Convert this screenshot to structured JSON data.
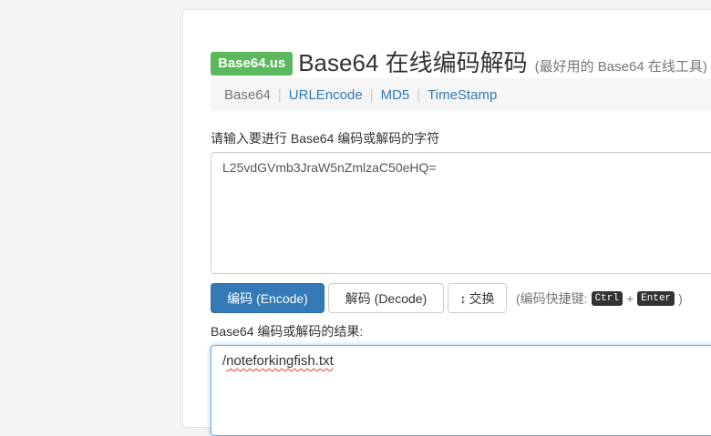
{
  "header": {
    "badge": "Base64.us",
    "title": "Base64 在线编码解码",
    "subtitle": "(最好用的 Base64 在线工具)"
  },
  "nav": {
    "active": "Base64",
    "links": [
      "URLEncode",
      "MD5",
      "TimeStamp"
    ],
    "separator": "|"
  },
  "input": {
    "label": "请输入要进行 Base64 编码或解码的字符",
    "value": "L25vdGVmb3JraW5nZmlzaC50eHQ="
  },
  "buttons": {
    "encode": "编码 (Encode)",
    "decode": "解码 (Decode)",
    "swap": "交换",
    "swap_icon": "↕"
  },
  "hint": {
    "prefix": "(编码快捷键:",
    "key1": "Ctrl",
    "plus": "+",
    "key2": "Enter",
    "suffix": ")"
  },
  "result": {
    "label": "Base64 编码或解码的结果:",
    "prefix": "/",
    "value": "noteforkingfish.txt"
  },
  "colors": {
    "badge": "#5cb85c",
    "primary": "#337ab7",
    "link": "#337ab7",
    "focus_border": "#66afe9"
  }
}
